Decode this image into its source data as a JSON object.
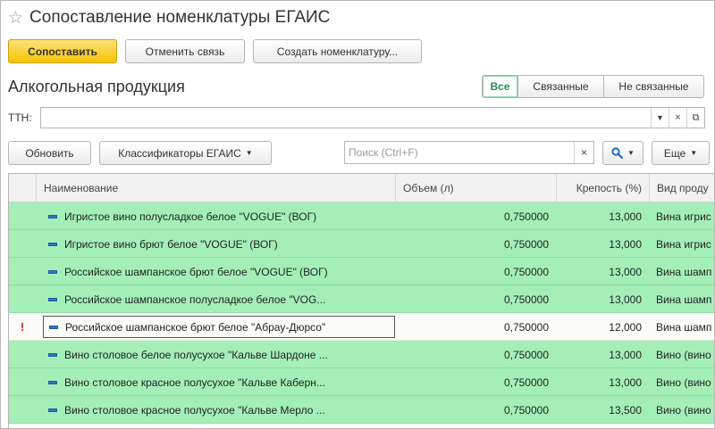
{
  "window": {
    "title": "Сопоставление номенклатуры ЕГАИС",
    "favorite_icon": "star-outline-icon"
  },
  "toolbar": {
    "match_label": "Сопоставить",
    "unlink_label": "Отменить связь",
    "create_label": "Создать номенклатуру..."
  },
  "section": {
    "title": "Алкогольная продукция"
  },
  "filter": {
    "all": "Все",
    "linked": "Связанные",
    "unlinked": "Не связанные",
    "active": "all"
  },
  "ttn": {
    "label": "ТТН:",
    "value": ""
  },
  "list_toolbar": {
    "refresh_label": "Обновить",
    "classifiers_label": "Классификаторы ЕГАИС",
    "search_placeholder": "Поиск (Ctrl+F)",
    "more_label": "Еще"
  },
  "table": {
    "columns": {
      "name": "Наименование",
      "volume": "Объем (л)",
      "strength": "Крепость (%)",
      "type": "Вид проду"
    },
    "rows": [
      {
        "mark": "",
        "name": "Игристое вино полусладкое белое \"VOGUE\" (ВОГ)",
        "volume": "0,750000",
        "strength": "13,000",
        "type": "Вина игрис",
        "matched": true
      },
      {
        "mark": "",
        "name": "Игристое вино брют белое \"VOGUE\" (ВОГ)",
        "volume": "0,750000",
        "strength": "13,000",
        "type": "Вина игрис",
        "matched": true
      },
      {
        "mark": "",
        "name": "Российское шампанское брют белое \"VOGUE\" (ВОГ)",
        "volume": "0,750000",
        "strength": "13,000",
        "type": "Вина шамп",
        "matched": true
      },
      {
        "mark": "",
        "name": "Российское шампанское полусладкое белое \"VOG...",
        "volume": "0,750000",
        "strength": "13,000",
        "type": "Вина шамп",
        "matched": true
      },
      {
        "mark": "!",
        "name": "Российское шампанское брют белое \"Абрау-Дюрсо\"",
        "volume": "0,750000",
        "strength": "12,000",
        "type": "Вина шамп",
        "matched": false
      },
      {
        "mark": "",
        "name": "Вино столовое белое полусухое \"Кальве Шардоне ...",
        "volume": "0,750000",
        "strength": "13,000",
        "type": "Вино (вино",
        "matched": true
      },
      {
        "mark": "",
        "name": "Вино столовое красное полусухое \"Кальве Каберн...",
        "volume": "0,750000",
        "strength": "13,000",
        "type": "Вино (вино",
        "matched": true
      },
      {
        "mark": "",
        "name": "Вино столовое красное полусухое \"Кальве Мерло ...",
        "volume": "0,750000",
        "strength": "13,500",
        "type": "Вино (вино",
        "matched": true
      }
    ]
  }
}
